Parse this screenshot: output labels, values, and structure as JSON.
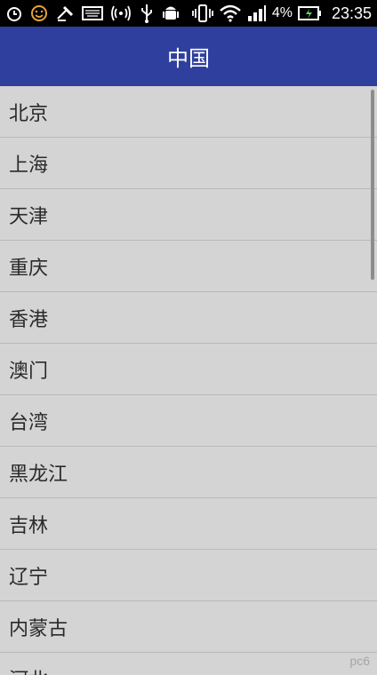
{
  "status_bar": {
    "left_icons": [
      "alarm-icon",
      "emoji-icon",
      "satellite-icon",
      "keyboard-icon",
      "hotspot-icon",
      "usb-icon",
      "android-debug-icon"
    ],
    "right_icons": [
      "vibrate-icon",
      "wifi-icon",
      "signal-icon"
    ],
    "battery_percent": "4%",
    "time": "23:35"
  },
  "header": {
    "title": "中国"
  },
  "list": {
    "items": [
      {
        "label": "北京"
      },
      {
        "label": "上海"
      },
      {
        "label": "天津"
      },
      {
        "label": "重庆"
      },
      {
        "label": "香港"
      },
      {
        "label": "澳门"
      },
      {
        "label": "台湾"
      },
      {
        "label": "黑龙江"
      },
      {
        "label": "吉林"
      },
      {
        "label": "辽宁"
      },
      {
        "label": "内蒙古"
      },
      {
        "label": "河北"
      }
    ]
  },
  "watermark": {
    "text": "pc6"
  },
  "colors": {
    "header_bg": "#2f3f9d",
    "list_bg": "#d4d4d4",
    "status_bg": "#000000"
  }
}
